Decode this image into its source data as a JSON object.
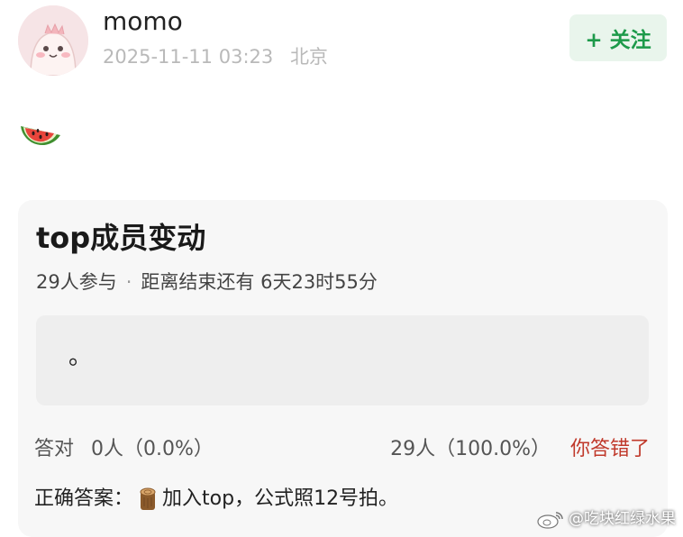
{
  "post": {
    "username": "momo",
    "timestamp": "2025-11-11 03:23",
    "location": "北京",
    "follow_label": "+ 关注",
    "emoji_icon": "watermelon-icon"
  },
  "poll": {
    "title": "top成员变动",
    "participants": "29人参与",
    "separator": "·",
    "time_left": "距离结束还有 6天23时55分",
    "option_text": "。",
    "correct_label": "答对",
    "correct_count": "0人",
    "correct_percent": "（0.0%）",
    "wrong_summary": "29人（100.0%）",
    "wrong_status": "你答错了",
    "answer_prefix": "正确答案：",
    "answer_icon": "log-icon",
    "answer_text": "加入top，公式照12号拍。",
    "wrong_color": "#c0392b"
  },
  "watermark": {
    "text": "@吃块红绿水果"
  },
  "colors": {
    "accent_green": "#1d9a4a",
    "follow_bg": "#e9f5ec",
    "card_bg": "#f7f7f7"
  }
}
